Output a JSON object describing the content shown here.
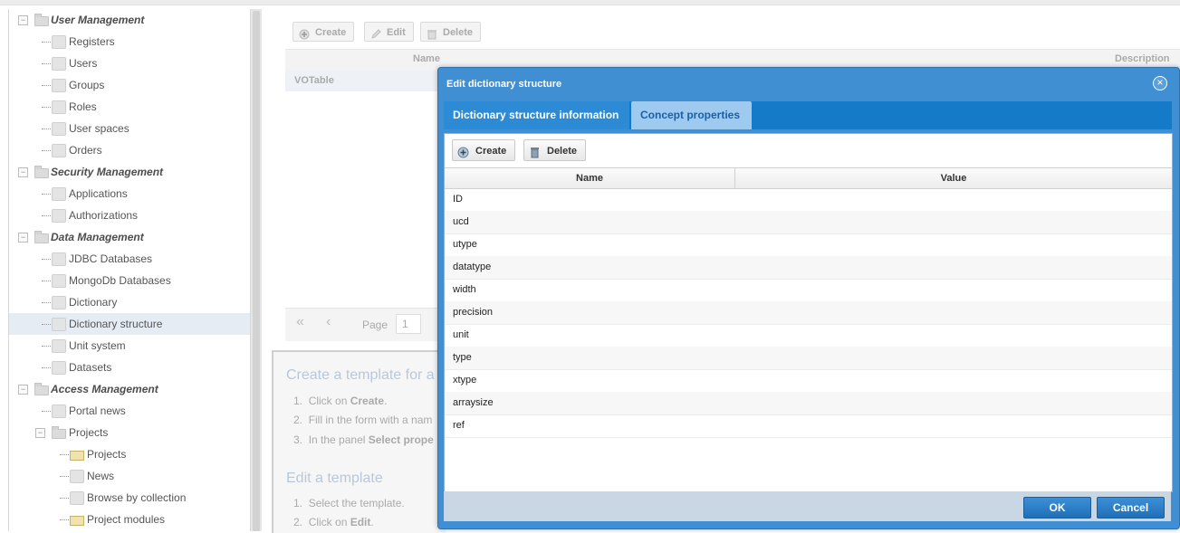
{
  "sidebar": {
    "items": [
      {
        "label": "User Management",
        "type": "group",
        "icon": "folder-icon"
      },
      {
        "label": "Registers",
        "type": "leaf",
        "icon": "registers-icon"
      },
      {
        "label": "Users",
        "type": "leaf",
        "icon": "user-icon"
      },
      {
        "label": "Groups",
        "type": "leaf",
        "icon": "groups-icon"
      },
      {
        "label": "Roles",
        "type": "leaf",
        "icon": "roles-icon"
      },
      {
        "label": "User spaces",
        "type": "leaf",
        "icon": "cloud-icon"
      },
      {
        "label": "Orders",
        "type": "leaf",
        "icon": "orders-icon"
      },
      {
        "label": "Security Management",
        "type": "group",
        "icon": "folder-icon"
      },
      {
        "label": "Applications",
        "type": "leaf",
        "icon": "applications-icon"
      },
      {
        "label": "Authorizations",
        "type": "leaf",
        "icon": "lock-icon"
      },
      {
        "label": "Data Management",
        "type": "group",
        "icon": "folder-icon"
      },
      {
        "label": "JDBC Databases",
        "type": "leaf",
        "icon": "database-icon"
      },
      {
        "label": "MongoDb Databases",
        "type": "leaf",
        "icon": "shield-icon"
      },
      {
        "label": "Dictionary",
        "type": "leaf",
        "icon": "book-icon"
      },
      {
        "label": "Dictionary structure",
        "type": "leaf",
        "icon": "book-icon",
        "selected": true
      },
      {
        "label": "Unit system",
        "type": "leaf",
        "icon": "ruler-icon"
      },
      {
        "label": "Datasets",
        "type": "leaf",
        "icon": "table-icon"
      },
      {
        "label": "Access Management",
        "type": "group",
        "icon": "folder-icon"
      },
      {
        "label": "Portal news",
        "type": "leaf",
        "icon": "rss-icon"
      },
      {
        "label": "Projects",
        "type": "subgroup",
        "icon": "folder-icon"
      },
      {
        "label": "Projects",
        "type": "subleaf",
        "icon": "project-folder-icon"
      },
      {
        "label": "News",
        "type": "subleaf",
        "icon": "rss-icon"
      },
      {
        "label": "Browse by collection",
        "type": "subleaf",
        "icon": "collection-icon"
      },
      {
        "label": "Project modules",
        "type": "subleaf",
        "icon": "project-folder-icon"
      }
    ]
  },
  "main": {
    "toolbar": {
      "create": "Create",
      "edit": "Edit",
      "delete": "Delete"
    },
    "grid": {
      "col_name": "Name",
      "col_description": "Description",
      "rows": [
        "VOTable"
      ]
    },
    "pager": {
      "page_label": "Page",
      "page_value": "1"
    },
    "help": {
      "title1": "Create a template for a",
      "steps1": [
        {
          "text": "Click on ",
          "bold": "Create",
          "rest": "."
        },
        {
          "text": "Fill in the form with a nam",
          "bold": "",
          "rest": ""
        },
        {
          "text": "In the panel ",
          "bold": "Select prope",
          "rest": ""
        }
      ],
      "title2": "Edit a template",
      "steps2": [
        {
          "text": "Select the template.",
          "bold": "",
          "rest": ""
        },
        {
          "text": "Click on ",
          "bold": "Edit",
          "rest": "."
        }
      ]
    }
  },
  "dialog": {
    "title": "Edit dictionary structure",
    "tabs": [
      "Dictionary structure information",
      "Concept properties"
    ],
    "active_tab": "Concept properties",
    "toolbar": {
      "create": "Create",
      "delete": "Delete"
    },
    "table": {
      "columns": [
        "Name",
        "Value"
      ],
      "rows": [
        {
          "name": "ID",
          "value": ""
        },
        {
          "name": "ucd",
          "value": ""
        },
        {
          "name": "utype",
          "value": ""
        },
        {
          "name": "datatype",
          "value": ""
        },
        {
          "name": "width",
          "value": ""
        },
        {
          "name": "precision",
          "value": ""
        },
        {
          "name": "unit",
          "value": ""
        },
        {
          "name": "type",
          "value": ""
        },
        {
          "name": "xtype",
          "value": ""
        },
        {
          "name": "arraysize",
          "value": ""
        },
        {
          "name": "ref",
          "value": ""
        }
      ]
    },
    "ok": "OK",
    "cancel": "Cancel"
  },
  "colors": {
    "dialog_header": "#3f8fd2",
    "tab_active": "#9fcaf0",
    "button_blue": "#2a7cc6"
  }
}
